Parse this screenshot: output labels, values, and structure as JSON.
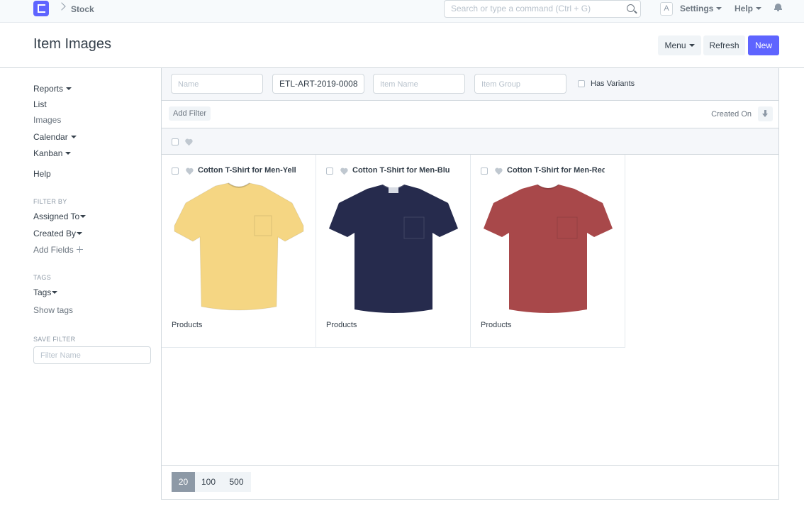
{
  "navbar": {
    "breadcrumb": "Stock",
    "search_placeholder": "Search or type a command (Ctrl + G)",
    "avatar_letter": "A",
    "settings_label": "Settings",
    "help_label": "Help"
  },
  "page": {
    "title": "Item Images",
    "menu_label": "Menu",
    "refresh_label": "Refresh",
    "new_label": "New"
  },
  "sidebar": {
    "reports": "Reports",
    "list": "List",
    "images": "Images",
    "calendar": "Calendar",
    "kanban": "Kanban",
    "help": "Help",
    "filter_by_heading": "FILTER BY",
    "assigned_to": "Assigned To",
    "created_by": "Created By",
    "add_fields": "Add Fields",
    "tags_heading": "TAGS",
    "tags": "Tags",
    "show_tags": "Show tags",
    "save_filter_heading": "SAVE FILTER",
    "filter_name_placeholder": "Filter Name"
  },
  "filters": {
    "name_placeholder": "Name",
    "article_value": "ETL-ART-2019-0008",
    "item_name_placeholder": "Item Name",
    "item_group_placeholder": "Item Group",
    "has_variants_label": "Has Variants",
    "add_filter_label": "Add Filter",
    "sort_label": "Created On"
  },
  "items": [
    {
      "title": "Cotton T-Shirt for Men-Yellow",
      "group": "Products",
      "color": "#f5d683"
    },
    {
      "title": "Cotton T-Shirt for Men-Blue",
      "group": "Products",
      "color": "#262b4d"
    },
    {
      "title": "Cotton T-Shirt for Men-Red",
      "group": "Products",
      "color": "#a8484a"
    }
  ],
  "paging": {
    "options": [
      "20",
      "100",
      "500"
    ],
    "selected": "20"
  },
  "colors": {
    "primary": "#5e64ff",
    "navbar_bg": "#f7fafc",
    "border": "#d1d8dd"
  }
}
